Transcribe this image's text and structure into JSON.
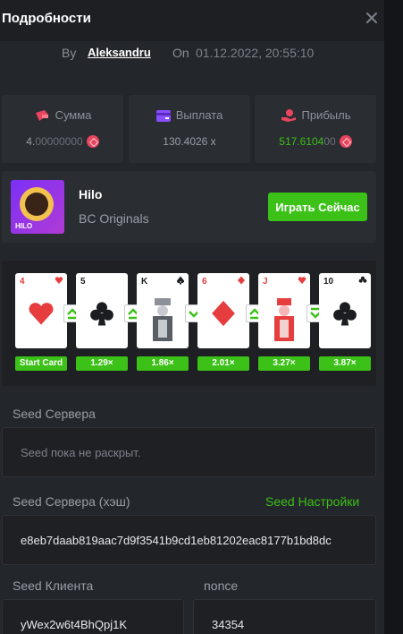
{
  "header": {
    "title": "Подробности"
  },
  "byline": {
    "by": "By",
    "user": "Aleksandru",
    "on": "On",
    "date": "01.12.2022, 20:55:10"
  },
  "stats": [
    {
      "label": "Сумма",
      "value_main": "4.",
      "value_dim": "00000000",
      "icon": "wallet-icon",
      "color": "#e8455e"
    },
    {
      "label": "Выплата",
      "value_main": "130.4026 x",
      "value_dim": "",
      "icon": "card-icon",
      "color": "#8a4dff"
    },
    {
      "label": "Прибыль",
      "value_main": "517.6104",
      "value_dim": "00",
      "icon": "hand-coin-icon",
      "color": "#e8455e"
    }
  ],
  "game": {
    "name": "Hilo",
    "provider": "BC Originals",
    "play_label": "Играть Сейчас",
    "thumb_text": "HILO"
  },
  "cards": [
    {
      "rank": "4",
      "suit": "♥",
      "mult": "Start Card"
    },
    {
      "rank": "5",
      "suit": "♣",
      "mult": "1.29×"
    },
    {
      "rank": "K",
      "suit": "♠",
      "mult": "1.86×"
    },
    {
      "rank": "6",
      "suit": "♦",
      "mult": "2.01×"
    },
    {
      "rank": "J",
      "suit": "♥",
      "mult": "3.27×"
    },
    {
      "rank": "10",
      "suit": "♣",
      "mult": "3.87×"
    }
  ],
  "seed_server": {
    "label": "Seed Сервера",
    "placeholder": "Seed пока не раскрыт."
  },
  "seed_hash": {
    "label": "Seed Сервера (хэш)",
    "settings": "Seed Настройки",
    "value": "e8eb7daab819aac7d9f3541b9cd1eb81202eac8177b1bd8dc"
  },
  "seed_client": {
    "label": "Seed Клиента",
    "value": "yWex2w6t4BhQpj1K"
  },
  "nonce": {
    "label": "nonce",
    "value": "34354"
  },
  "colors": {
    "accent": "#3bc117",
    "red": "#e63e3e"
  }
}
